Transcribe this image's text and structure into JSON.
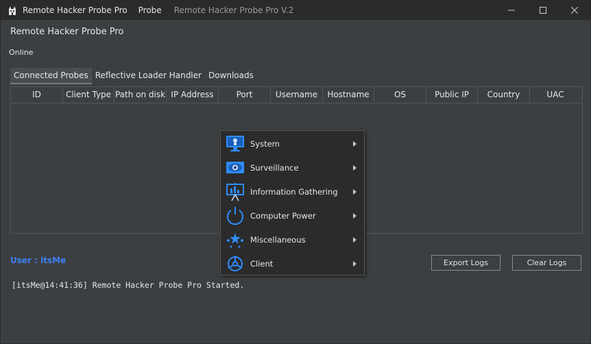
{
  "titlebar": {
    "app_title": "Remote Hacker Probe Pro",
    "menu_probe": "Probe",
    "version": "Remote Hacker Probe Pro V.2"
  },
  "header": {
    "title": "Remote Hacker Probe Pro",
    "status": "Online"
  },
  "tabs": [
    {
      "label": "Connected Probes"
    },
    {
      "label": "Reflective Loader Handler"
    },
    {
      "label": "Downloads"
    }
  ],
  "table": {
    "columns": [
      "ID",
      "Client Type",
      "Path on disk",
      "IP Address",
      "Port",
      "Username",
      "Hostname",
      "OS",
      "Public IP",
      "Country",
      "UAC"
    ],
    "rows": []
  },
  "context_menu": {
    "items": [
      {
        "label": "System",
        "icon": "monitor-icon"
      },
      {
        "label": "Surveillance",
        "icon": "eye-icon"
      },
      {
        "label": "Information Gathering",
        "icon": "presentation-icon"
      },
      {
        "label": "Computer Power",
        "icon": "power-icon"
      },
      {
        "label": "Miscellaneous",
        "icon": "stars-icon"
      },
      {
        "label": "Client",
        "icon": "helm-icon"
      }
    ]
  },
  "user": {
    "label": "User : itsMe"
  },
  "buttons": {
    "export_logs": "Export Logs",
    "clear_logs": "Clear Logs"
  },
  "logs": [
    "[itsMe@14:41:36] Remote Hacker Probe Pro Started."
  ],
  "colors": {
    "accent": "#3b82f6",
    "icon_blue": "#2f8cff",
    "window_bg": "#3c3f41",
    "titlebar_bg": "#2b2b2b"
  }
}
